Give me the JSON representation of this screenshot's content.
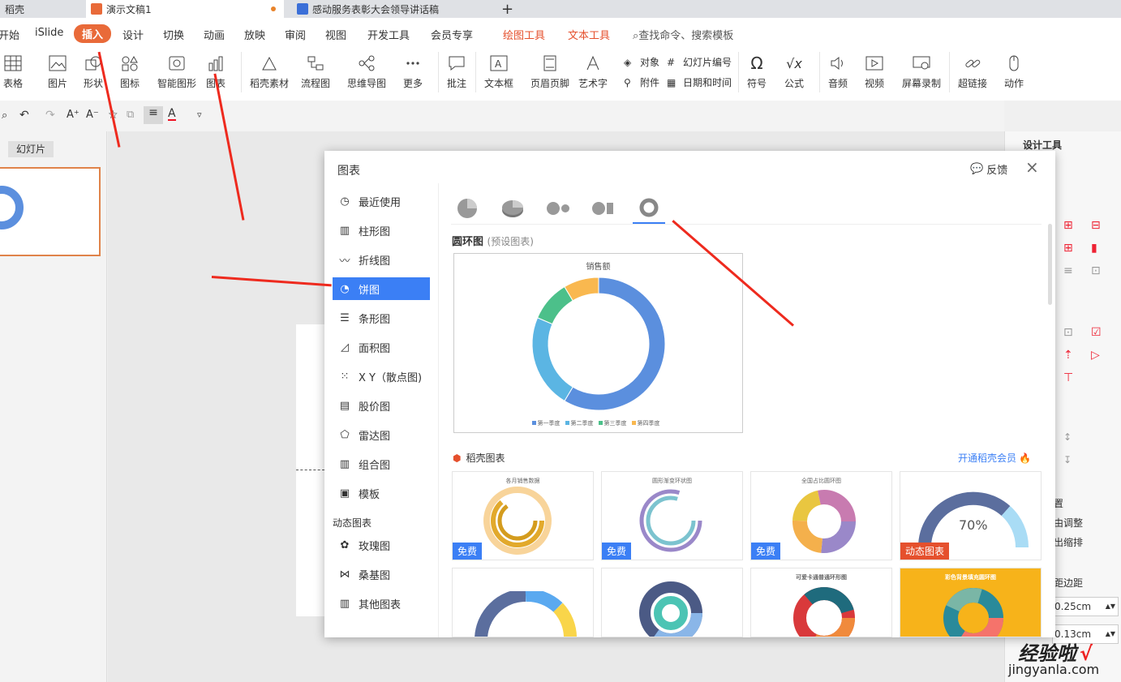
{
  "tabs": {
    "t1": "稻壳",
    "t2": "演示文稿1",
    "t3": "感动服务表彰大会领导讲话稿",
    "add": "+"
  },
  "menu": {
    "start": "开始",
    "islide": "iSlide",
    "insert": "插入",
    "design": "设计",
    "transition": "切换",
    "animation": "动画",
    "slideshow": "放映",
    "review": "审阅",
    "view": "视图",
    "developer": "开发工具",
    "member": "会员专享",
    "drawing": "绘图工具",
    "text_tool": "文本工具",
    "search": "查找命令、搜索模板"
  },
  "ribbon": {
    "table": "表格",
    "picture": "图片",
    "shape": "形状",
    "icon": "图标",
    "smartart": "智能图形",
    "chart": "图表",
    "docer": "稻壳素材",
    "flow": "流程图",
    "mind": "思维导图",
    "more": "更多",
    "comment": "批注",
    "textbox": "文本框",
    "header": "页眉页脚",
    "wordart": "艺术字",
    "object": "对象",
    "attach": "附件",
    "slideno": "幻灯片编号",
    "datetime": "日期和时间",
    "symbol": "符号",
    "formula": "公式",
    "audio": "音频",
    "video": "视频",
    "screenrec": "屏幕录制",
    "hyperlink": "超链接",
    "action": "动作"
  },
  "left_panel": {
    "slides_label": "幻灯片"
  },
  "right_panel": {
    "title": "设计工具",
    "opt1": "由调整",
    "opt2": "出缩排",
    "margin_label": "距边距",
    "margin1": "0.25cm",
    "margin2": "0.13cm",
    "partial": "置"
  },
  "dialog": {
    "title": "图表",
    "feedback": "反馈",
    "categories": [
      "最近使用",
      "柱形图",
      "折线图",
      "饼图",
      "条形图",
      "面积图",
      "X Y（散点图)",
      "股价图",
      "雷达图",
      "组合图",
      "模板"
    ],
    "dynamic_header": "动态图表",
    "dynamic": [
      "玫瑰图",
      "桑基图",
      "其他图表"
    ],
    "section_title": "圆环图",
    "section_sub": "(预设图表)",
    "docer_title": "稻壳图表",
    "docer_link": "开通稻壳会员",
    "cards": [
      "各月销售数据",
      "圆形渐变环状图",
      "全国占比圆环图",
      "",
      "",
      "",
      "可爱卡通普通环形图",
      "彩色背景填充圆环图"
    ],
    "badges": {
      "free": "免费",
      "dynamic": "动态图表"
    },
    "card4_value": "70%"
  },
  "chart_data": {
    "type": "pie",
    "title": "销售额",
    "categories": [
      "第一季度",
      "第二季度",
      "第三季度",
      "第四季度"
    ],
    "values": [
      8.2,
      3.2,
      1.4,
      1.2
    ],
    "colors": [
      "#5b8fde",
      "#5bb5e3",
      "#4cc08a",
      "#f9b84f"
    ]
  },
  "watermark": {
    "text": "经验啦",
    "url": "jingyanla.com",
    "check": "√"
  }
}
